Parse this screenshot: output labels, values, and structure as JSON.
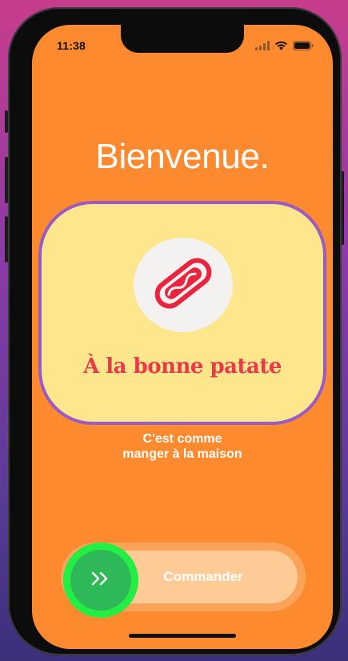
{
  "status_bar": {
    "time": "11:38"
  },
  "welcome": {
    "title": "Bienvenue."
  },
  "card": {
    "brand_name": "À la bonne patate"
  },
  "tagline": {
    "line1": "C'est comme",
    "line2": "manger à la maison"
  },
  "order_slider": {
    "label": "Commander"
  },
  "icons": {
    "logo": "hotdog-icon",
    "knob": "double-chevron-right-icon",
    "signal": "cellular-signal-icon",
    "wifi": "wifi-icon",
    "battery": "battery-icon"
  },
  "colors": {
    "background": "#fd8a2f",
    "card": "#fee68c",
    "card_border": "#9b5bc4",
    "brand_text": "#ea3a4a",
    "knob": "#2fb858",
    "knob_ring": "#22ee44",
    "slider_track": "#fecb97"
  }
}
